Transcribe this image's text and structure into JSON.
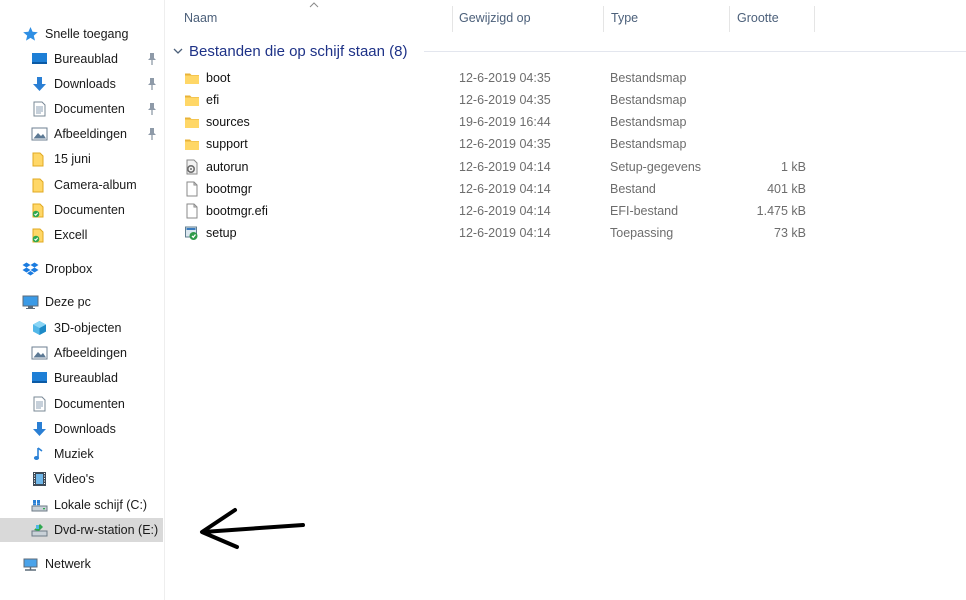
{
  "nav": {
    "quick_access": "Snelle toegang",
    "quick_items": [
      {
        "label": "Bureaublad",
        "pinned": true
      },
      {
        "label": "Downloads",
        "pinned": true
      },
      {
        "label": "Documenten",
        "pinned": true
      },
      {
        "label": "Afbeeldingen",
        "pinned": true
      },
      {
        "label": "15 juni",
        "pinned": false
      },
      {
        "label": "Camera-album",
        "pinned": false
      },
      {
        "label": "Documenten",
        "pinned": false
      },
      {
        "label": "Excell",
        "pinned": false
      }
    ],
    "dropbox": "Dropbox",
    "this_pc": "Deze pc",
    "pc_items": [
      {
        "label": "3D-objecten",
        "icon": "cube-icon"
      },
      {
        "label": "Afbeeldingen",
        "icon": "pictures-icon"
      },
      {
        "label": "Bureaublad",
        "icon": "desktop-icon"
      },
      {
        "label": "Documenten",
        "icon": "documents-icon"
      },
      {
        "label": "Downloads",
        "icon": "download-arrow-icon"
      },
      {
        "label": "Muziek",
        "icon": "music-note-icon"
      },
      {
        "label": "Video's",
        "icon": "film-icon"
      },
      {
        "label": "Lokale schijf (C:)",
        "icon": "local-disk-icon"
      },
      {
        "label": "Dvd-rw-station (E:)",
        "icon": "dvd-drive-icon",
        "selected": true
      }
    ],
    "network": "Netwerk"
  },
  "columns": {
    "name": "Naam",
    "modified": "Gewijzigd op",
    "type": "Type",
    "size": "Grootte"
  },
  "group": {
    "title": "Bestanden die op schijf staan (8)"
  },
  "files": [
    {
      "name": "boot",
      "modified": "12-6-2019 04:35",
      "type": "Bestandsmap",
      "size": "",
      "icon": "folder-icon"
    },
    {
      "name": "efi",
      "modified": "12-6-2019 04:35",
      "type": "Bestandsmap",
      "size": "",
      "icon": "folder-icon"
    },
    {
      "name": "sources",
      "modified": "19-6-2019 16:44",
      "type": "Bestandsmap",
      "size": "",
      "icon": "folder-icon"
    },
    {
      "name": "support",
      "modified": "12-6-2019 04:35",
      "type": "Bestandsmap",
      "size": "",
      "icon": "folder-icon"
    },
    {
      "name": "autorun",
      "modified": "12-6-2019 04:14",
      "type": "Setup-gegevens",
      "size": "1 kB",
      "icon": "settings-file-icon"
    },
    {
      "name": "bootmgr",
      "modified": "12-6-2019 04:14",
      "type": "Bestand",
      "size": "401 kB",
      "icon": "file-icon"
    },
    {
      "name": "bootmgr.efi",
      "modified": "12-6-2019 04:14",
      "type": "EFI-bestand",
      "size": "1.475 kB",
      "icon": "file-icon"
    },
    {
      "name": "setup",
      "modified": "12-6-2019 04:14",
      "type": "Toepassing",
      "size": "73 kB",
      "icon": "setup-app-icon"
    }
  ],
  "colors": {
    "group_title": "#1e3287",
    "header_text": "#4c607a",
    "folder": "#ffd767",
    "selection": "#d9d9d9"
  }
}
